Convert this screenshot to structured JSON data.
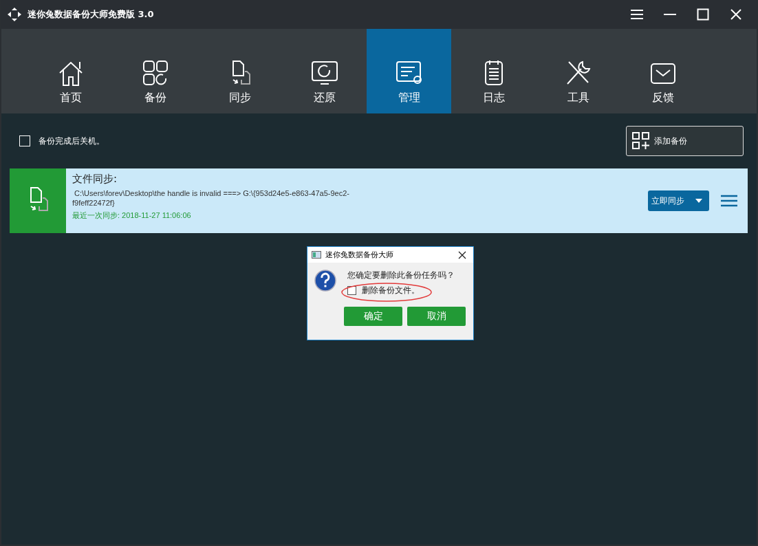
{
  "window": {
    "title": "迷你兔数据备份大师免费版",
    "version": "3.0"
  },
  "tabs": [
    {
      "label": "首页",
      "selected": false
    },
    {
      "label": "备份",
      "selected": false
    },
    {
      "label": "同步",
      "selected": false
    },
    {
      "label": "还原",
      "selected": false
    },
    {
      "label": "管理",
      "selected": true
    },
    {
      "label": "日志",
      "selected": false
    },
    {
      "label": "工具",
      "selected": false
    },
    {
      "label": "反馈",
      "selected": false
    }
  ],
  "shutdown_option": {
    "label": "备份完成后关机。",
    "checked": false
  },
  "add_button": "添加备份",
  "tasks": [
    {
      "title": "文件同步:",
      "path": " C:\\Users\\forev\\Desktop\\the handle is invalid ===> G:\\{953d24e5-e863-47a5-9ec2-\nf9feff22472f}",
      "last_label": "最近一次同步:",
      "last_time": " 2018-11-27 11:06:06",
      "action": "立即同步"
    }
  ],
  "dialog": {
    "title": "迷你兔数据备份大师",
    "message": "您确定要删除此备份任务吗？",
    "option": {
      "label": "删除备份文件。",
      "checked": false
    },
    "buttons": [
      "确定",
      "取消"
    ]
  }
}
